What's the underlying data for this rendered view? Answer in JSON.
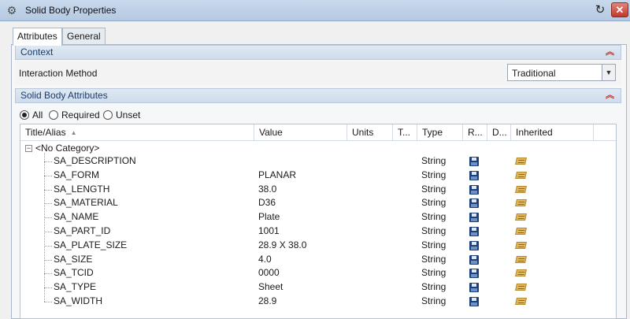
{
  "window": {
    "title": "Solid Body Properties",
    "restore_symbol": "↻",
    "close_symbol": "✕"
  },
  "tabs": [
    {
      "label": "Attributes",
      "active": true
    },
    {
      "label": "General",
      "active": false
    }
  ],
  "context": {
    "header": "Context",
    "field_label": "Interaction Method",
    "select_value": "Traditional"
  },
  "attributes": {
    "header": "Solid Body Attributes",
    "filters": [
      {
        "label": "All",
        "selected": true
      },
      {
        "label": "Required",
        "selected": false
      },
      {
        "label": "Unset",
        "selected": false
      }
    ],
    "columns": [
      "Title/Alias",
      "Value",
      "Units",
      "T...",
      "Type",
      "R...",
      "D...",
      "Inherited"
    ],
    "category": "<No Category>",
    "rows": [
      {
        "title": "SA_DESCRIPTION",
        "value": "",
        "type": "String"
      },
      {
        "title": "SA_FORM",
        "value": "PLANAR",
        "type": "String"
      },
      {
        "title": "SA_LENGTH",
        "value": "38.0",
        "type": "String"
      },
      {
        "title": "SA_MATERIAL",
        "value": "D36",
        "type": "String"
      },
      {
        "title": "SA_NAME",
        "value": "Plate",
        "type": "String"
      },
      {
        "title": "SA_PART_ID",
        "value": "1001",
        "type": "String"
      },
      {
        "title": "SA_PLATE_SIZE",
        "value": "28.9 X 38.0",
        "type": "String"
      },
      {
        "title": "SA_SIZE",
        "value": "4.0",
        "type": "String"
      },
      {
        "title": "SA_TCID",
        "value": "0000",
        "type": "String"
      },
      {
        "title": "SA_TYPE",
        "value": "Sheet",
        "type": "String"
      },
      {
        "title": "SA_WIDTH",
        "value": "28.9",
        "type": "String"
      }
    ]
  },
  "colors": {
    "header_text": "#1b3c6b",
    "collapse_accent": "#c0392b",
    "close_button": "#c1392b"
  },
  "icons": {
    "title": "gear-icon",
    "collapse": "double-chevron-up-icon",
    "dropdown": "chevron-down-icon",
    "read_only": "floppy-disk-icon",
    "inherited": "inherit-icon"
  }
}
